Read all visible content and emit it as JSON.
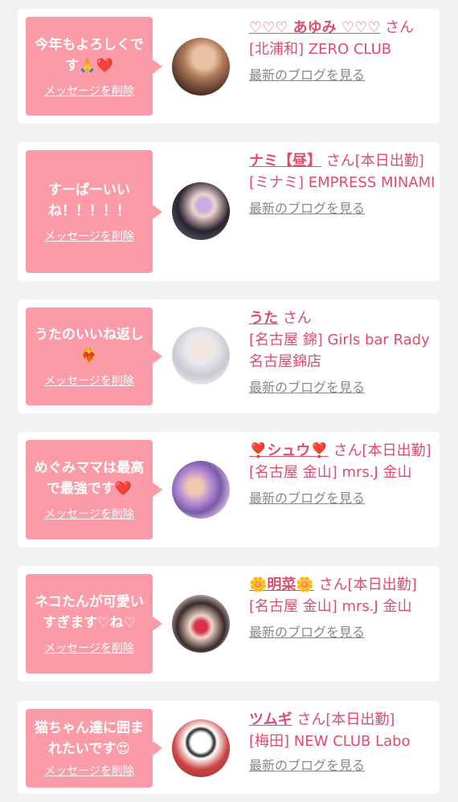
{
  "delete_label": "メッセージを削除",
  "blog_label": "最新のブログを見る",
  "items": [
    {
      "message": "今年もよろしくです🙏❤️",
      "name": "♡♡♡ あゆみ ♡♡♡",
      "suffix": "さん",
      "shop": "[北浦和] ZERO CLUB"
    },
    {
      "message": "すーぱーいいね！！！！！",
      "name": "ナミ【昼】",
      "suffix": "さん[本日出勤]",
      "shop": "[ミナミ] EMPRESS MINAMI"
    },
    {
      "message": "うたのいいね返し❤️‍🔥",
      "name": "うた",
      "suffix": "さん",
      "shop": "[名古屋 錦] Girls bar Rady 名古屋錦店"
    },
    {
      "message": "めぐみママは最高で最強です❤️",
      "name": "❣️シュウ❣️",
      "suffix": "さん[本日出勤]",
      "shop": "[名古屋 金山] mrs.J 金山"
    },
    {
      "message": "ネコたんが可愛いすぎます♡ね♡",
      "name": "🌼明菜🌼",
      "suffix": "さん[本日出勤]",
      "shop": "[名古屋 金山] mrs.J 金山"
    },
    {
      "message": "猫ちゃん達に囲まれたいです😍",
      "name": "ツムギ",
      "suffix": "さん[本日出勤]",
      "shop": "[梅田] NEW CLUB Labo"
    }
  ]
}
